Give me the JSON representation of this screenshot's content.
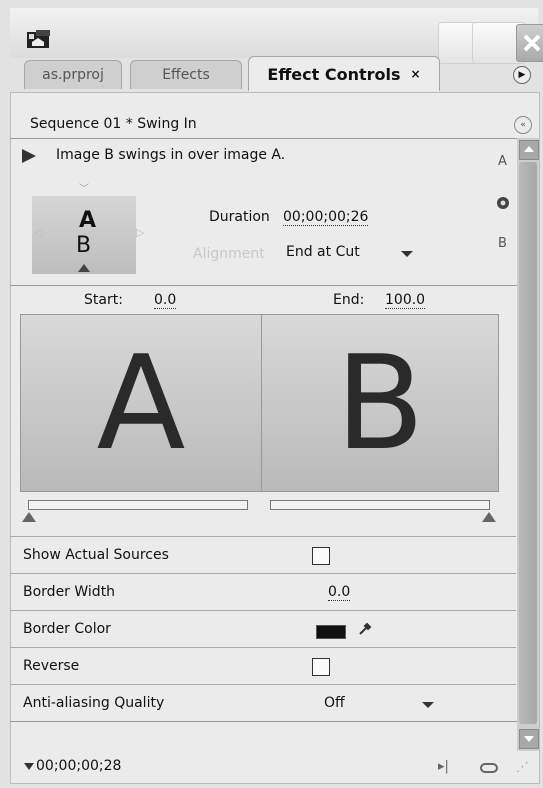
{
  "tabs": [
    {
      "label": "as.prproj"
    },
    {
      "label": "Effects"
    },
    {
      "label": "Effect Controls",
      "close": "×"
    }
  ],
  "sequence": {
    "label": "Sequence 01 * Swing In"
  },
  "effect": {
    "description": "Image B swings in over image A.",
    "thumbnail": {
      "top_letter": "A",
      "bottom_letter": "B"
    },
    "duration_label": "Duration",
    "duration_value": "00;00;00;26",
    "alignment_label": "Alignment",
    "alignment_value": "End at Cut",
    "side_top": "A",
    "side_bottom": "B"
  },
  "range": {
    "start_label": "Start:",
    "start_value": "0.0",
    "end_label": "End:",
    "end_value": "100.0"
  },
  "preview": {
    "left_letter": "A",
    "right_letter": "B"
  },
  "properties": [
    {
      "label": "Show Actual Sources",
      "type": "checkbox",
      "checked": false
    },
    {
      "label": "Border Width",
      "type": "number",
      "value": "0.0"
    },
    {
      "label": "Border Color",
      "type": "color",
      "value": "#111111"
    },
    {
      "label": "Reverse",
      "type": "checkbox",
      "checked": false
    },
    {
      "label": "Anti-aliasing Quality",
      "type": "select",
      "value": "Off"
    }
  ],
  "footer": {
    "timecode": "00;00;00;28"
  }
}
